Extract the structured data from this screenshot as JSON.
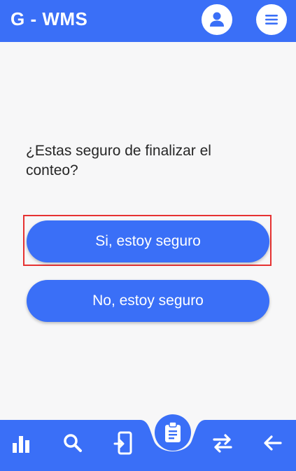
{
  "header": {
    "title": "G - WMS",
    "profile_icon": "account-icon",
    "menu_icon": "menu-icon"
  },
  "dialog": {
    "question": "¿Estas seguro de finalizar el conteo?",
    "confirm_label": "Si, estoy seguro",
    "cancel_label": "No, estoy seguro"
  },
  "bottom_nav": {
    "items": [
      {
        "icon": "bar-chart-icon"
      },
      {
        "icon": "search-icon"
      },
      {
        "icon": "phone-login-icon"
      },
      {
        "icon": "clipboard-icon",
        "active": true
      },
      {
        "icon": "swap-icon"
      },
      {
        "icon": "arrow-back-icon"
      }
    ]
  },
  "colors": {
    "primary": "#3a6ff7",
    "background": "#f7f7f8",
    "highlight": "#e63232"
  }
}
